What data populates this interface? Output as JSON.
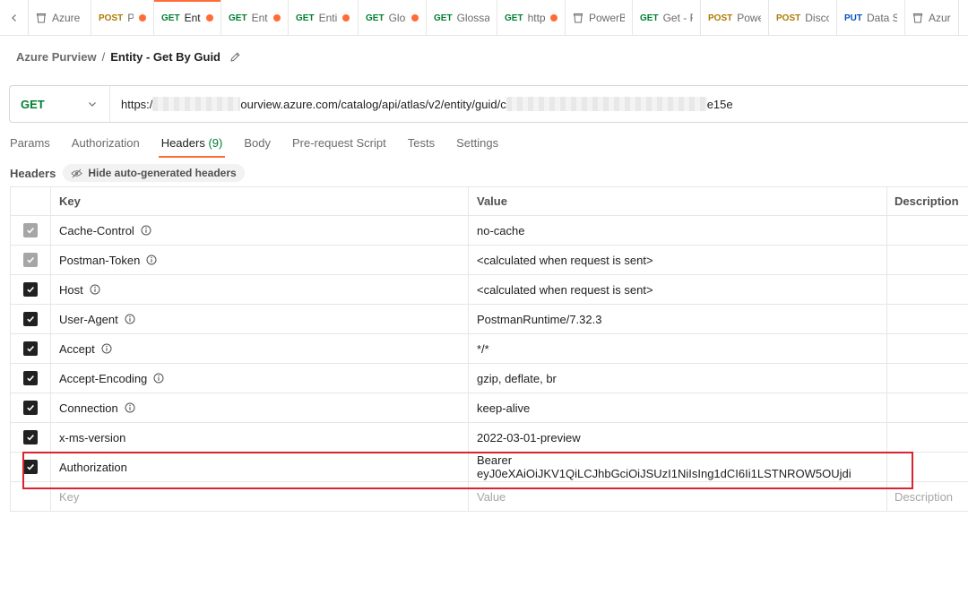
{
  "tabs": [
    {
      "kind": "collection",
      "method": "",
      "name": "Azure F",
      "dot": false,
      "active": false
    },
    {
      "kind": "request",
      "method": "POST",
      "name": "Pui",
      "dot": true,
      "active": false
    },
    {
      "kind": "request",
      "method": "GET",
      "name": "Enti",
      "dot": true,
      "active": true
    },
    {
      "kind": "request",
      "method": "GET",
      "name": "Entit",
      "dot": true,
      "active": false
    },
    {
      "kind": "request",
      "method": "GET",
      "name": "Enti",
      "dot": true,
      "active": false
    },
    {
      "kind": "request",
      "method": "GET",
      "name": "Glos",
      "dot": true,
      "active": false
    },
    {
      "kind": "request",
      "method": "GET",
      "name": "Glossa",
      "dot": false,
      "active": false
    },
    {
      "kind": "request",
      "method": "GET",
      "name": "http",
      "dot": true,
      "active": false
    },
    {
      "kind": "collection",
      "method": "",
      "name": "PowerB",
      "dot": false,
      "active": false
    },
    {
      "kind": "request",
      "method": "GET",
      "name": "Get - F",
      "dot": false,
      "active": false
    },
    {
      "kind": "request",
      "method": "POST",
      "name": "Powe",
      "dot": false,
      "active": false
    },
    {
      "kind": "request",
      "method": "POST",
      "name": "Disco",
      "dot": false,
      "active": false
    },
    {
      "kind": "request",
      "method": "PUT",
      "name": "Data S",
      "dot": false,
      "active": false
    },
    {
      "kind": "collection",
      "method": "",
      "name": "Azure",
      "dot": false,
      "active": false
    }
  ],
  "breadcrumb": {
    "parent": "Azure Purview",
    "separator": "/",
    "title": "Entity - Get By Guid"
  },
  "request": {
    "method": "GET",
    "url_prefix": "https:/",
    "url_middle": "ourview.azure.com/catalog/api/atlas/v2/entity/guid/c",
    "url_suffix": "e15e"
  },
  "request_tabs": [
    {
      "label": "Params",
      "count": "",
      "active": false
    },
    {
      "label": "Authorization",
      "count": "",
      "active": false
    },
    {
      "label": "Headers",
      "count": "(9)",
      "active": true
    },
    {
      "label": "Body",
      "count": "",
      "active": false
    },
    {
      "label": "Pre-request Script",
      "count": "",
      "active": false
    },
    {
      "label": "Tests",
      "count": "",
      "active": false
    },
    {
      "label": "Settings",
      "count": "",
      "active": false
    }
  ],
  "headers_section": {
    "label": "Headers",
    "hide_button": "Hide auto-generated headers"
  },
  "table": {
    "columns": {
      "key": "Key",
      "value": "Value",
      "description": "Description"
    },
    "rows": [
      {
        "key": "Cache-Control",
        "value": "no-cache",
        "checked": true,
        "disabled": true,
        "info": true
      },
      {
        "key": "Postman-Token",
        "value": "<calculated when request is sent>",
        "checked": true,
        "disabled": true,
        "info": true
      },
      {
        "key": "Host",
        "value": "<calculated when request is sent>",
        "checked": true,
        "disabled": false,
        "info": true
      },
      {
        "key": "User-Agent",
        "value": "PostmanRuntime/7.32.3",
        "checked": true,
        "disabled": false,
        "info": true
      },
      {
        "key": "Accept",
        "value": "*/*",
        "checked": true,
        "disabled": false,
        "info": true
      },
      {
        "key": "Accept-Encoding",
        "value": "gzip, deflate, br",
        "checked": true,
        "disabled": false,
        "info": true
      },
      {
        "key": "Connection",
        "value": "keep-alive",
        "checked": true,
        "disabled": false,
        "info": true
      },
      {
        "key": "x-ms-version",
        "value": "2022-03-01-preview",
        "checked": true,
        "disabled": false,
        "info": false
      },
      {
        "key": "Authorization",
        "value": "Bearer eyJ0eXAiOiJKV1QiLCJhbGciOiJSUzI1NiIsIng1dCI6Ii1LSTNROW5OUjdi",
        "checked": true,
        "disabled": false,
        "info": false
      }
    ],
    "placeholder": {
      "key": "Key",
      "value": "Value",
      "description": "Description"
    }
  },
  "colors": {
    "accent": "#ff6c37",
    "get": "#007f31",
    "post": "#ad7a03",
    "put": "#0053b8",
    "highlight": "#d9232d"
  }
}
